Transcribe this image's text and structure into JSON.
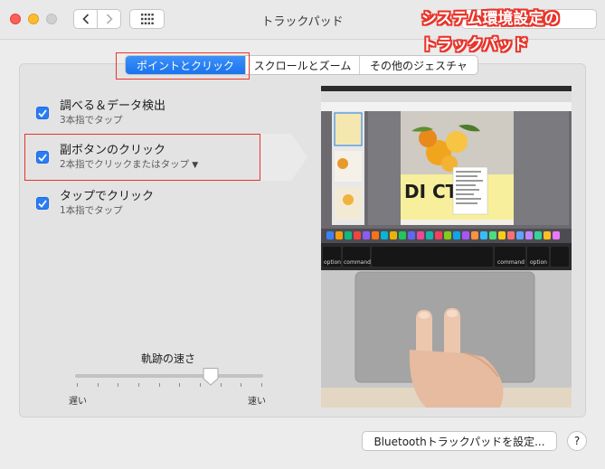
{
  "window": {
    "title": "トラックパッド"
  },
  "annotation": {
    "line1": "システム環境設定の",
    "line2": "トラックパッド"
  },
  "tabs": [
    {
      "label": "ポイントとクリック",
      "active": true
    },
    {
      "label": "スクロールとズーム",
      "active": false
    },
    {
      "label": "その他のジェスチャ",
      "active": false
    }
  ],
  "options": [
    {
      "title": "調べる＆データ検出",
      "subtitle": "3本指でタップ",
      "checked": true
    },
    {
      "title": "副ボタンのクリック",
      "subtitle": "2本指でクリックまたはタップ",
      "checked": true
    },
    {
      "title": "タップでクリック",
      "subtitle": "1本指でタップ",
      "checked": true
    }
  ],
  "tracking_speed": {
    "label": "軌跡の速さ",
    "min_label": "遅い",
    "max_label": "速い",
    "value_fraction": 0.72
  },
  "preview": {
    "key_option_left": "option",
    "key_command_left": "command",
    "key_command_right": "command",
    "key_option_right": "option",
    "poster_text": "DI    CT"
  },
  "footer": {
    "bluetooth_button": "Bluetoothトラックパッドを設定...",
    "help_button": "?"
  },
  "colors": {
    "accent": "#1a73ee",
    "annotation_red": "#e8352b"
  }
}
